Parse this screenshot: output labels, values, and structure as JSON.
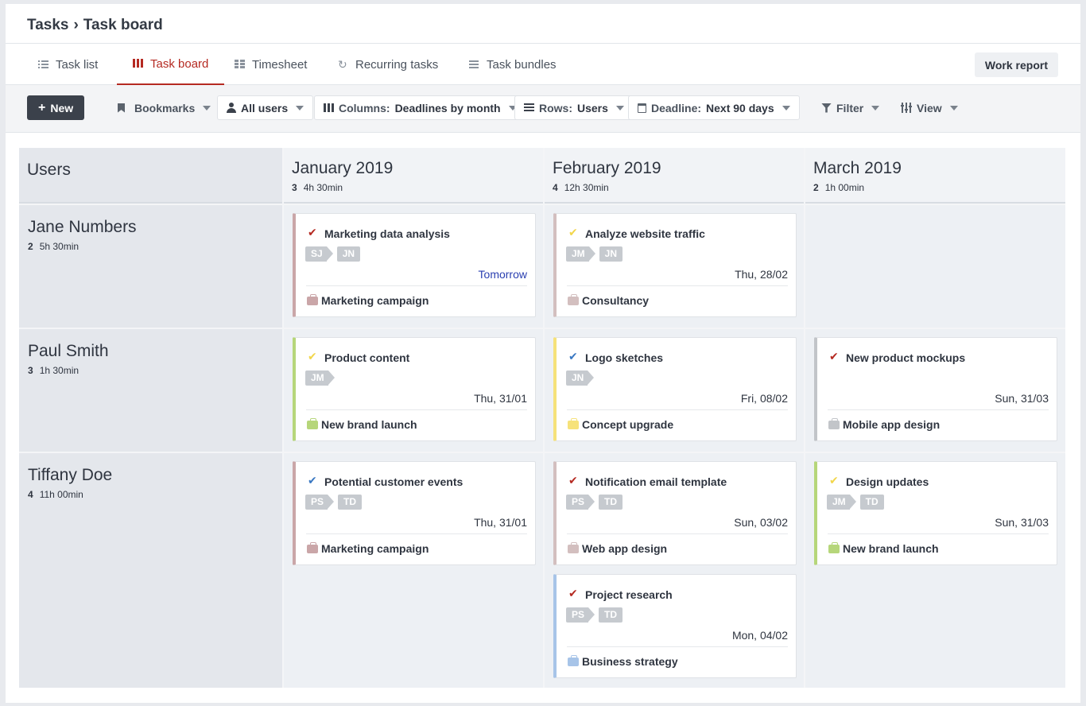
{
  "breadcrumb": {
    "root": "Tasks",
    "separator": "›",
    "current": "Task board"
  },
  "tabs": [
    {
      "label": "Task list",
      "icon": "list-icon"
    },
    {
      "label": "Task board",
      "icon": "board-icon",
      "active": true
    },
    {
      "label": "Timesheet",
      "icon": "timesheet-icon"
    },
    {
      "label": "Recurring tasks",
      "icon": "recurring-icon"
    },
    {
      "label": "Task bundles",
      "icon": "bundles-icon"
    }
  ],
  "work_report_label": "Work report",
  "toolbar": {
    "new_label": "New",
    "bookmarks_label": "Bookmarks",
    "users_label": "All users",
    "columns_prefix": "Columns:",
    "columns_value": "Deadlines by month",
    "rows_prefix": "Rows:",
    "rows_value": "Users",
    "deadline_prefix": "Deadline:",
    "deadline_value": "Next 90 days",
    "filter_label": "Filter",
    "view_label": "View"
  },
  "board": {
    "users_header": "Users",
    "columns": [
      {
        "title": "January 2019",
        "count": "3",
        "time": "4h 30min"
      },
      {
        "title": "February 2019",
        "count": "4",
        "time": "12h 30min"
      },
      {
        "title": "March 2019",
        "count": "2",
        "time": "1h 00min"
      }
    ],
    "rows": [
      {
        "name": "Jane Numbers",
        "count": "2",
        "time": "5h 30min"
      },
      {
        "name": "Paul Smith",
        "count": "3",
        "time": "1h 30min"
      },
      {
        "name": "Tiffany Doe",
        "count": "4",
        "time": "11h 00min"
      }
    ],
    "cards": [
      {
        "title": "Marketing data analysis",
        "check_color": "#b52a22",
        "assigner": "SJ",
        "assignee": "JN",
        "due": "Tomorrow",
        "project": "Marketing campaign",
        "color": "#caa6a8"
      },
      {
        "title": "Analyze website traffic",
        "check_color": "#f2d64b",
        "assigner": "JM",
        "assignee": "JN",
        "due": "Thu, 28/02",
        "project": "Consultancy",
        "color": "#d3bfbf"
      },
      {
        "title": "Product content",
        "check_color": "#f2d64b",
        "assigner": "JM",
        "assignee": "",
        "due": "Thu, 31/01",
        "project": "New brand launch",
        "color": "#b6d67a"
      },
      {
        "title": "Logo sketches",
        "check_color": "#3a78c2",
        "assigner": "JN",
        "assignee": "",
        "due": "Fri, 08/02",
        "project": "Concept upgrade",
        "color": "#f6e27a"
      },
      {
        "title": "New product mockups",
        "check_color": "#b52a22",
        "assigner": "",
        "assignee": "",
        "due": "Sun, 31/03",
        "project": "Mobile app design",
        "color": "#c2c5c9"
      },
      {
        "title": "Potential customer events",
        "check_color": "#3a78c2",
        "assigner": "PS",
        "assignee": "TD",
        "due": "Thu, 31/01",
        "project": "Marketing campaign",
        "color": "#caa6a8"
      },
      {
        "title": "Notification email template",
        "check_color": "#b52a22",
        "assigner": "PS",
        "assignee": "TD",
        "due": "Sun, 03/02",
        "project": "Web app design",
        "color": "#d3bfbf"
      },
      {
        "title": "Project research",
        "check_color": "#b52a22",
        "assigner": "PS",
        "assignee": "TD",
        "due": "Mon, 04/02",
        "project": "Business strategy",
        "color": "#a7c4e8"
      },
      {
        "title": "Design updates",
        "check_color": "#f2d64b",
        "assigner": "JM",
        "assignee": "TD",
        "due": "Sun, 31/03",
        "project": "New brand launch",
        "color": "#b6d67a"
      }
    ]
  }
}
